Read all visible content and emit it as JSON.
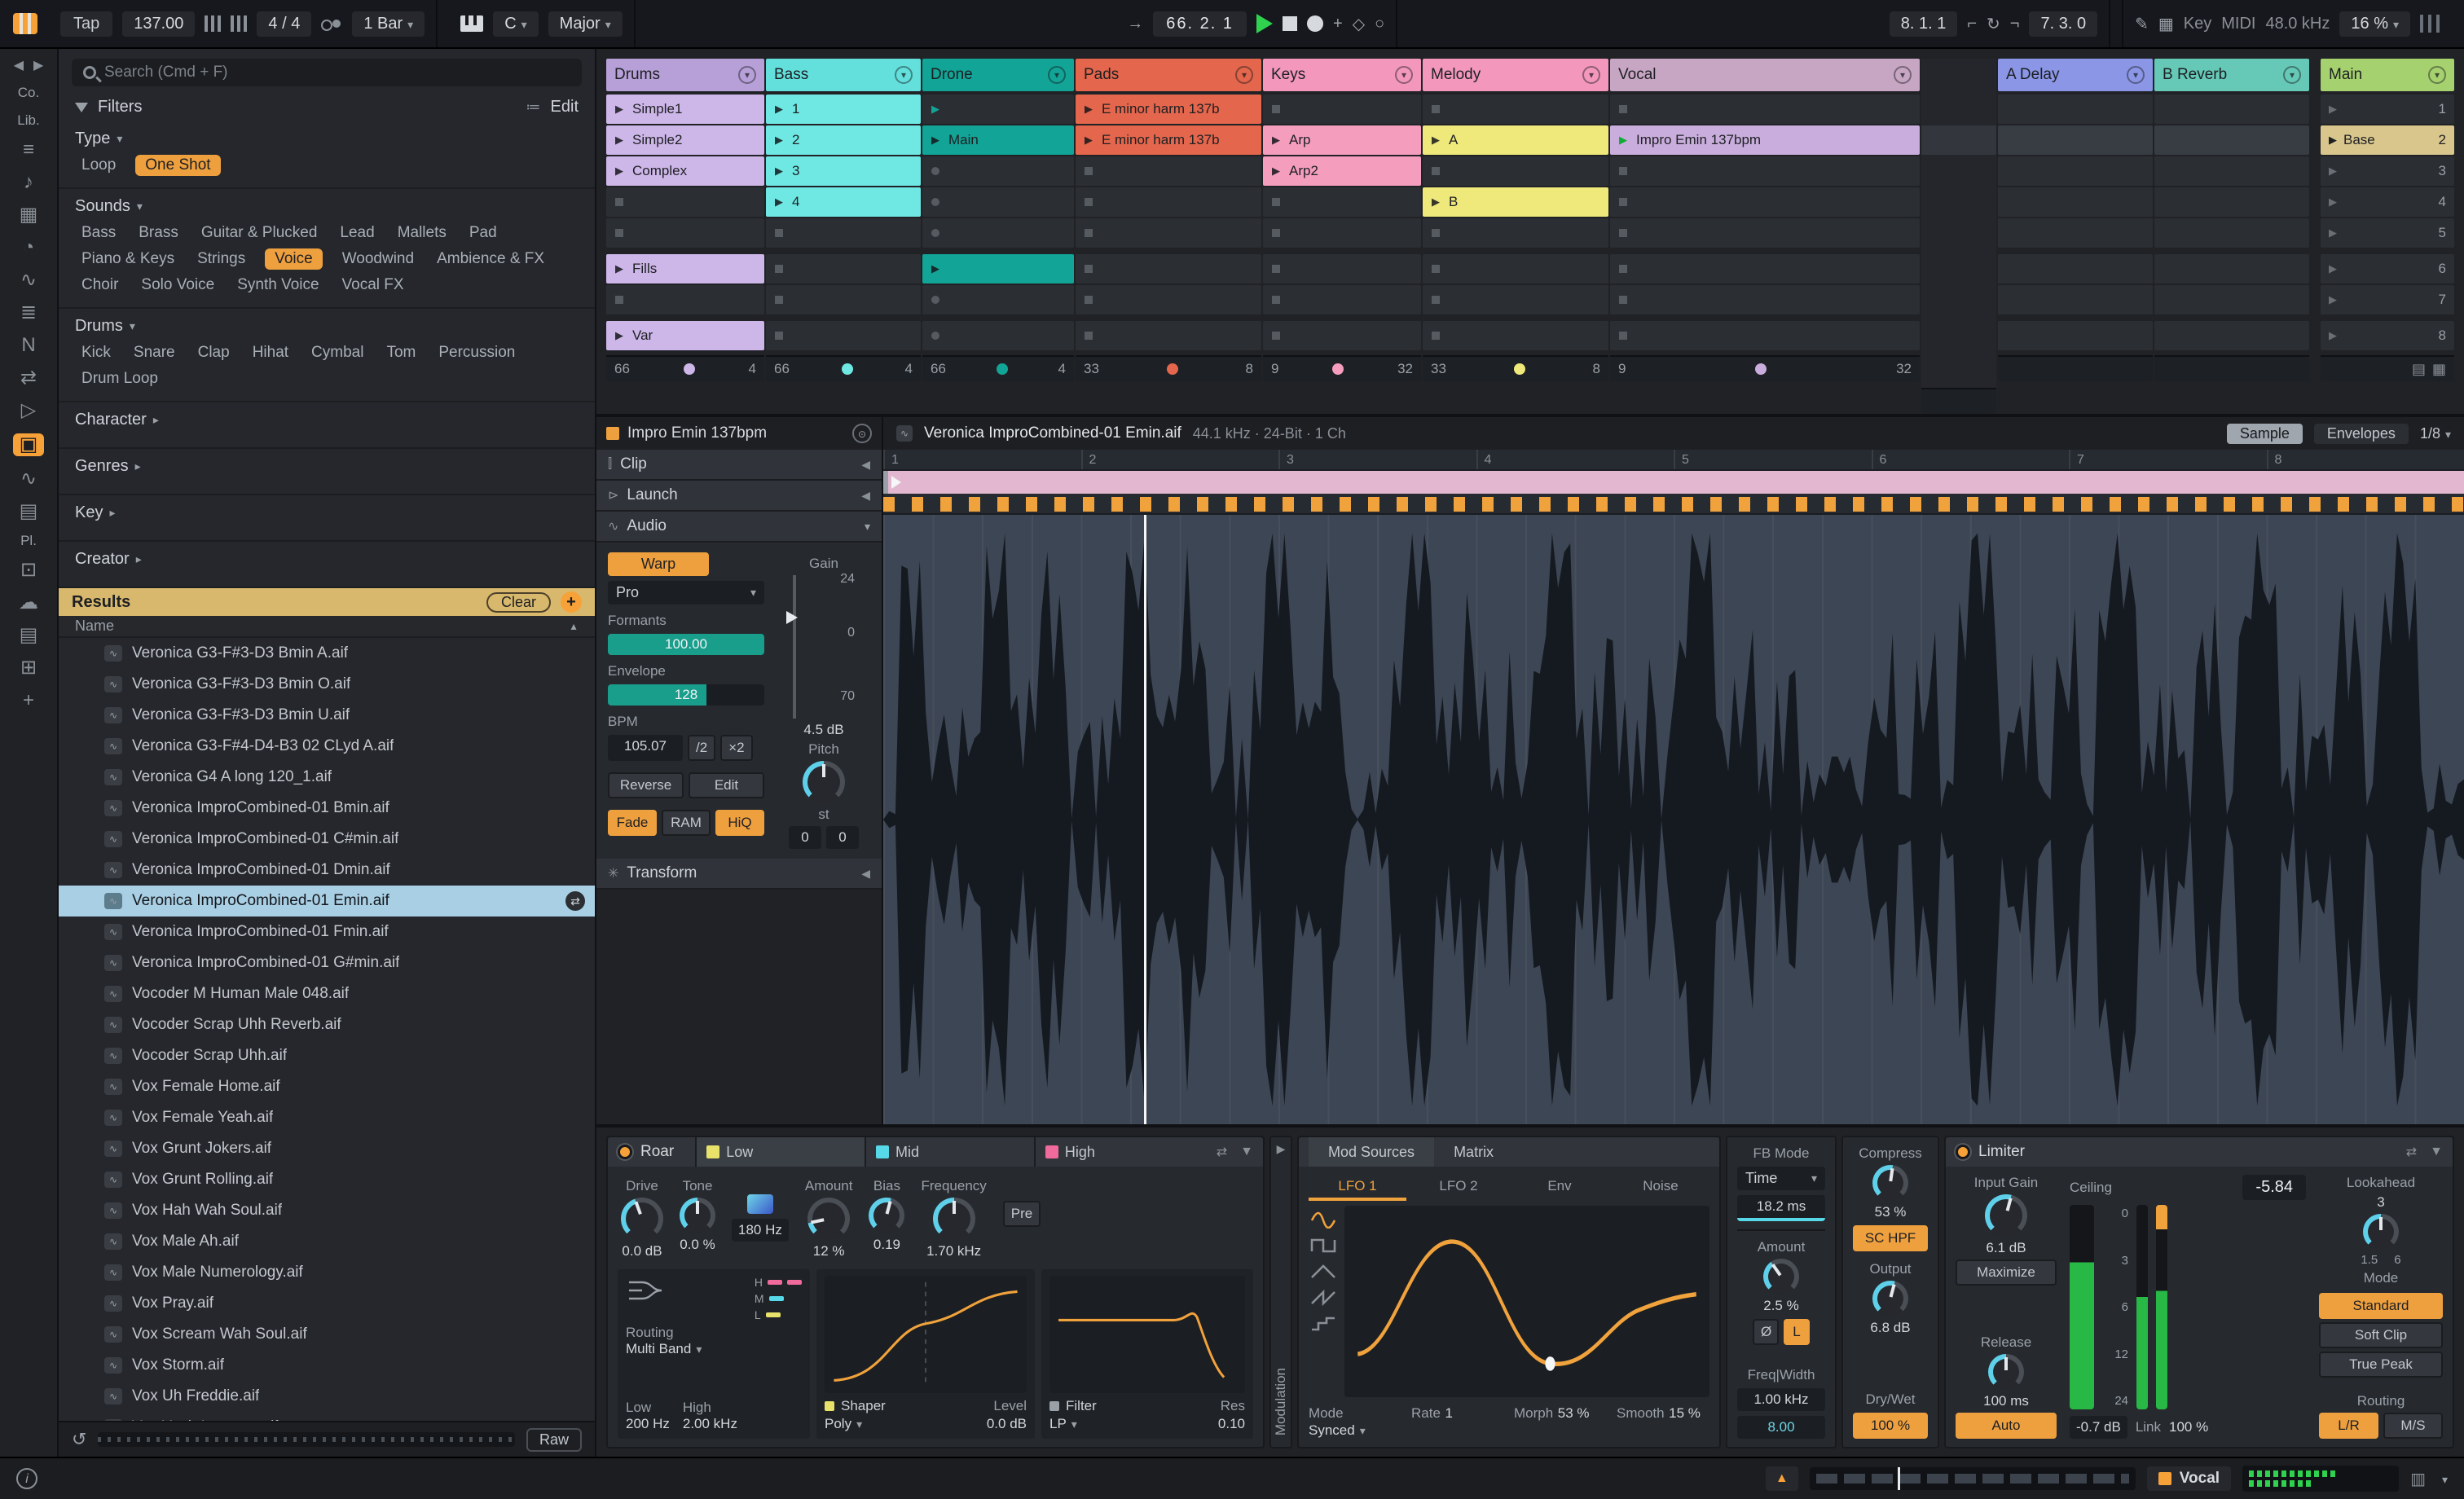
{
  "transport": {
    "tap": "Tap",
    "tempo": "137.00",
    "time_sig": "4 / 4",
    "quantize": "1 Bar",
    "key_root": "C",
    "key_scale": "Major",
    "position": "66. 2. 1",
    "loop_start": "8. 1. 1",
    "loop_length": "7. 3. 0",
    "key_map_label": "Key",
    "midi_label": "MIDI",
    "sample_rate": "48.0 kHz",
    "cpu": "16 %"
  },
  "rail": {
    "back": "◀",
    "forward": "▶",
    "collections_label": "Co.",
    "library_label": "Lib.",
    "places_label": "Pl.",
    "items": [
      {
        "g": "≡",
        "n": "categories-icon"
      },
      {
        "g": "♪",
        "n": "sounds-icon"
      },
      {
        "g": "▦",
        "n": "drums-icon"
      },
      {
        "g": "◔",
        "n": "clock-icon"
      },
      {
        "g": "∿",
        "n": "audio-effects-icon"
      },
      {
        "g": "≣",
        "n": "instruments-icon"
      },
      {
        "g": "N",
        "n": "midi-effects-icon"
      },
      {
        "g": "⇄",
        "n": "max-for-live-icon"
      },
      {
        "g": "▷",
        "n": "plugins-icon"
      },
      {
        "g": "▣",
        "n": "samples-icon",
        "active": true
      },
      {
        "g": "∿",
        "n": "grooves-icon"
      },
      {
        "g": "▤",
        "n": "templates-icon"
      }
    ],
    "bottom_items": [
      {
        "g": "⊡",
        "n": "user-library-icon"
      },
      {
        "g": "☁",
        "n": "cloud-icon"
      },
      {
        "g": "▤",
        "n": "current-project-icon"
      },
      {
        "g": "⊞",
        "n": "add-folder-icon"
      },
      {
        "g": "+",
        "n": "plus-icon"
      }
    ]
  },
  "browser": {
    "search_placeholder": "Search (Cmd + F)",
    "filters_label": "Filters",
    "edit_label": "Edit",
    "sections": [
      {
        "label": "Type",
        "arrow": "▾",
        "chips": [
          {
            "label": "Loop"
          },
          {
            "label": "One Shot",
            "active": true
          }
        ]
      },
      {
        "label": "Sounds",
        "arrow": "▾",
        "chips": [
          {
            "label": "Bass"
          },
          {
            "label": "Brass"
          },
          {
            "label": "Guitar & Plucked"
          },
          {
            "label": "Lead"
          },
          {
            "label": "Mallets"
          },
          {
            "label": "Pad"
          },
          {
            "label": "Piano & Keys"
          },
          {
            "label": "Strings"
          },
          {
            "label": "Voice",
            "active": true
          },
          {
            "label": "Woodwind"
          },
          {
            "label": "Ambience & FX"
          },
          {
            "label": "Choir"
          },
          {
            "label": "Solo Voice"
          },
          {
            "label": "Synth Voice"
          },
          {
            "label": "Vocal FX"
          }
        ]
      },
      {
        "label": "Drums",
        "arrow": "▾",
        "chips": [
          {
            "label": "Kick"
          },
          {
            "label": "Snare"
          },
          {
            "label": "Clap"
          },
          {
            "label": "Hihat"
          },
          {
            "label": "Cymbal"
          },
          {
            "label": "Tom"
          },
          {
            "label": "Percussion"
          },
          {
            "label": "Drum Loop"
          }
        ]
      },
      {
        "label": "Character",
        "arrow": "▸",
        "chips": []
      },
      {
        "label": "Genres",
        "arrow": "▸",
        "chips": []
      },
      {
        "label": "Key",
        "arrow": "▸",
        "chips": []
      },
      {
        "label": "Creator",
        "arrow": "▸",
        "chips": []
      }
    ],
    "results_label": "Results",
    "clear_label": "Clear",
    "plus_label": "+",
    "name_header": "Name",
    "files": [
      {
        "label": "Veronica G3-F#3-D3 Bmin A.aif"
      },
      {
        "label": "Veronica G3-F#3-D3 Bmin O.aif"
      },
      {
        "label": "Veronica G3-F#3-D3 Bmin U.aif"
      },
      {
        "label": "Veronica G3-F#4-D4-B3 02 CLyd A.aif"
      },
      {
        "label": "Veronica G4 A long 120_1.aif"
      },
      {
        "label": "Veronica ImproCombined-01 Bmin.aif"
      },
      {
        "label": "Veronica ImproCombined-01 C#min.aif"
      },
      {
        "label": "Veronica ImproCombined-01 Dmin.aif"
      },
      {
        "label": "Veronica ImproCombined-01 Emin.aif",
        "selected": true
      },
      {
        "label": "Veronica ImproCombined-01 Fmin.aif"
      },
      {
        "label": "Veronica ImproCombined-01 G#min.aif"
      },
      {
        "label": "Vocoder M Human Male 048.aif"
      },
      {
        "label": "Vocoder Scrap Uhh Reverb.aif"
      },
      {
        "label": "Vocoder Scrap Uhh.aif"
      },
      {
        "label": "Vox Female Home.aif"
      },
      {
        "label": "Vox Female Yeah.aif"
      },
      {
        "label": "Vox Grunt Jokers.aif"
      },
      {
        "label": "Vox Grunt Rolling.aif"
      },
      {
        "label": "Vox Hah Wah Soul.aif"
      },
      {
        "label": "Vox Male Ah.aif"
      },
      {
        "label": "Vox Male Numerology.aif"
      },
      {
        "label": "Vox Pray.aif"
      },
      {
        "label": "Vox Scream Wah Soul.aif"
      },
      {
        "label": "Vox Storm.aif"
      },
      {
        "label": "Vox Uh Freddie.aif"
      },
      {
        "label": "Vox Yeah Ironman.aif"
      }
    ],
    "raw_label": "Raw"
  },
  "session": {
    "tracks": [
      {
        "name": "Drums",
        "color": "#b7a0d8",
        "counter": {
          "l": "66",
          "r": "4",
          "c": "#cdb6e8"
        },
        "slots": [
          {
            "t": "clip",
            "label": "Simple1",
            "color": "#cdb6e8"
          },
          {
            "t": "clip",
            "label": "Simple2",
            "color": "#cdb6e8"
          },
          {
            "t": "clip",
            "label": "Complex",
            "color": "#cdb6e8"
          },
          {
            "t": "stop"
          },
          {
            "t": "stop"
          },
          {
            "t": "clip",
            "label": "Fills",
            "color": "#cdb6e8"
          },
          {
            "t": "stop"
          },
          {
            "t": "clip",
            "label": "Var",
            "color": "#cdb6e8"
          }
        ]
      },
      {
        "name": "Bass",
        "color": "#63e0dc",
        "counter": {
          "l": "66",
          "r": "4",
          "c": "#6fe8e3"
        },
        "slots": [
          {
            "t": "clip",
            "label": "1",
            "color": "#6fe8e3"
          },
          {
            "t": "clip",
            "label": "2",
            "color": "#6fe8e3"
          },
          {
            "t": "clip",
            "label": "3",
            "color": "#6fe8e3"
          },
          {
            "t": "clip",
            "label": "4",
            "color": "#6fe8e3"
          },
          {
            "t": "stop"
          },
          {
            "t": "stop"
          },
          {
            "t": "stop"
          },
          {
            "t": "stop"
          }
        ]
      },
      {
        "name": "Drone",
        "color": "#12a496",
        "counter": {
          "l": "66",
          "r": "4",
          "c": "#12a496"
        },
        "slots": [
          {
            "t": "playslot"
          },
          {
            "t": "clip",
            "label": "Main",
            "color": "#12a496"
          },
          {
            "t": "dot"
          },
          {
            "t": "dot"
          },
          {
            "t": "dot"
          },
          {
            "t": "clip",
            "label": "",
            "color": "#12a496"
          },
          {
            "t": "dot"
          },
          {
            "t": "dot"
          }
        ]
      },
      {
        "name": "Pads",
        "color": "#e4664c",
        "counter": {
          "l": "33",
          "r": "8",
          "c": "#e4664c"
        },
        "slots": [
          {
            "t": "clip",
            "label": "E minor harm 137b",
            "color": "#e4664c"
          },
          {
            "t": "clip",
            "label": "E minor harm 137b",
            "color": "#e4664c"
          },
          {
            "t": "stop"
          },
          {
            "t": "stop"
          },
          {
            "t": "stop"
          },
          {
            "t": "stop"
          },
          {
            "t": "stop"
          },
          {
            "t": "stop"
          }
        ]
      },
      {
        "name": "Keys",
        "color": "#f398bc",
        "counter": {
          "l": "9",
          "r": "32",
          "c": "#f49dbd"
        },
        "slots": [
          {
            "t": "stop"
          },
          {
            "t": "clip",
            "label": "Arp",
            "color": "#f49dbd"
          },
          {
            "t": "clip",
            "label": "Arp2",
            "color": "#f49dbd"
          },
          {
            "t": "stop"
          },
          {
            "t": "stop"
          },
          {
            "t": "stop"
          },
          {
            "t": "stop"
          },
          {
            "t": "stop"
          }
        ]
      },
      {
        "name": "Melody",
        "color": "#f398bc",
        "counter": {
          "l": "33",
          "r": "8",
          "c": "#efe87b"
        },
        "slots": [
          {
            "t": "stop"
          },
          {
            "t": "clip",
            "label": "A",
            "color": "#efe87b"
          },
          {
            "t": "stop"
          },
          {
            "t": "clip",
            "label": "B",
            "color": "#efe87b"
          },
          {
            "t": "stop"
          },
          {
            "t": "stop"
          },
          {
            "t": "stop"
          },
          {
            "t": "stop"
          }
        ]
      },
      {
        "name": "Vocal",
        "color": "#c7a6c3",
        "counter": {
          "l": "9",
          "r": "32",
          "c": "#c9addc"
        },
        "slots": [
          {
            "t": "stop"
          },
          {
            "t": "clip",
            "label": "Impro Emin 137bpm",
            "color": "#c9addc",
            "p": "green"
          },
          {
            "t": "stop"
          },
          {
            "t": "stop"
          },
          {
            "t": "stop"
          },
          {
            "t": "stop"
          },
          {
            "t": "stop"
          },
          {
            "t": "stop"
          }
        ]
      }
    ],
    "returns": [
      {
        "name": "A Delay",
        "color": "#8b97e6",
        "slots": [
          {
            "t": "empty"
          },
          {
            "t": "empty",
            "hl": true
          },
          {
            "t": "empty"
          },
          {
            "t": "empty"
          },
          {
            "t": "empty"
          },
          {
            "t": "empty"
          },
          {
            "t": "empty"
          },
          {
            "t": "empty"
          }
        ]
      },
      {
        "name": "B Reverb",
        "color": "#66c9b7",
        "slots": [
          {
            "t": "empty"
          },
          {
            "t": "empty",
            "hl": true
          },
          {
            "t": "empty"
          },
          {
            "t": "empty"
          },
          {
            "t": "empty"
          },
          {
            "t": "empty"
          },
          {
            "t": "empty"
          },
          {
            "t": "empty"
          }
        ]
      }
    ],
    "main": {
      "name": "Main",
      "color": "#a6d16f",
      "scenes": [
        {
          "n": "1"
        },
        {
          "n": "2",
          "label": "Base",
          "sel": true
        },
        {
          "n": "3"
        },
        {
          "n": "4"
        },
        {
          "n": "5"
        },
        {
          "n": "6"
        },
        {
          "n": "7"
        },
        {
          "n": "8"
        }
      ]
    }
  },
  "clip": {
    "title": "Impro Emin 137bpm",
    "section_clip": "Clip",
    "section_launch": "Launch",
    "section_audio": "Audio",
    "section_transform": "Transform",
    "warp_label": "Warp",
    "warp_mode": "Pro",
    "formants_label": "Formants",
    "formants_value": "100.00",
    "formants_pct": "100%",
    "envelope_label": "Envelope",
    "envelope_value": "128",
    "envelope_pct": "63%",
    "bpm_label": "BPM",
    "bpm_value": "105.07",
    "div2": "/2",
    "mul2": "×2",
    "gain_label": "Gain",
    "gain_tick_top": "24",
    "gain_tick_mid": "0",
    "gain_tick_low": "70",
    "gain_value": "4.5 dB",
    "pitch_label": "Pitch",
    "pitch_unit": "st",
    "pitch_st": "0",
    "pitch_fine": "0",
    "pitch_sw": 135,
    "reverse_label": "Reverse",
    "edit_label": "Edit",
    "fade_label": "Fade",
    "ram_label": "RAM",
    "hiq_label": "HiQ"
  },
  "sample": {
    "filename": "Veronica ImproCombined-01 Emin.aif",
    "specs": "44.1 kHz · 24-Bit · 1 Ch",
    "tab_sample": "Sample",
    "tab_envelopes": "Envelopes",
    "zoom": "1/8",
    "ruler": [
      "1",
      "2",
      "3",
      "4",
      "5",
      "6",
      "7",
      "8"
    ]
  },
  "devices": {
    "roar": {
      "title": "Roar",
      "tabs": [
        {
          "label": "Low",
          "color": "#e8e26a",
          "on": true
        },
        {
          "label": "Mid",
          "color": "#57d8e8"
        },
        {
          "label": "High",
          "color": "#f06a9c"
        }
      ],
      "drive": {
        "label": "Drive",
        "value": "0.0 dB",
        "sw": 115
      },
      "tone": {
        "label": "Tone",
        "value": "0.0 %",
        "sw": 135
      },
      "xover": "180 Hz",
      "amount": {
        "label": "Amount",
        "value": "12 %",
        "sw": 33
      },
      "bias": {
        "label": "Bias",
        "value": "0.19",
        "sw": 150
      },
      "freq": {
        "label": "Frequency",
        "value": "1.70 kHz",
        "sw": 135
      },
      "pre_label": "Pre",
      "routing_label": "Routing",
      "routing_mode": "Multi Band",
      "low_label": "Low",
      "low_value": "200 Hz",
      "high_label": "High",
      "high_value": "2.00 kHz",
      "shaper_label": "Shaper",
      "shaper_mode": "Poly",
      "level_label": "Level",
      "level_value": "0.0 dB",
      "filter_label": "Filter",
      "filter_mode": "LP",
      "res_label": "Res",
      "res_value": "0.10",
      "modulation_label": "Modulation",
      "band_h": "H",
      "band_m": "M",
      "band_l": "L"
    },
    "mod": {
      "tab_sources": "Mod Sources",
      "tab_matrix": "Matrix",
      "lfo_tabs": [
        {
          "label": "LFO 1",
          "on": true
        },
        {
          "label": "LFO 2"
        },
        {
          "label": "Env"
        },
        {
          "label": "Noise"
        }
      ],
      "mode_label": "Mode",
      "mode_value": "Synced",
      "rate_label": "Rate",
      "rate_value": "1",
      "morph_label": "Morph",
      "morph_value": "53 %",
      "smooth_label": "Smooth",
      "smooth_value": "15 %"
    },
    "fb": {
      "label": "FB Mode",
      "mode": "Time",
      "time": "18.2 ms",
      "amount_label": "Amount",
      "amount_value": "2.5 %",
      "amount_sw": 100,
      "phase": "Ø",
      "listen": "L",
      "freqwidth_label": "Freq|Width",
      "freq": "1.00 kHz",
      "width": "8.00"
    },
    "out": {
      "compress_label": "Compress",
      "compress_value": "53 %",
      "compress_sw": 143,
      "schpf": "SC HPF",
      "output_label": "Output",
      "output_value": "6.8 dB",
      "output_sw": 150,
      "drywet_label": "Dry/Wet",
      "drywet_value": "100 %"
    },
    "limiter": {
      "title": "Limiter",
      "input_label": "Input Gain",
      "input_value": "6.1 dB",
      "input_sw": 150,
      "maximize": "Maximize",
      "ceiling_label": "Ceiling",
      "ceiling_value": "-5.84",
      "meter_ticks": [
        "0",
        "3",
        "6",
        "12",
        "24"
      ],
      "lookahead_label": "Lookahead",
      "lookahead_value": "3",
      "lookahead_min": "1.5",
      "lookahead_max": "6",
      "lookahead_sw": 135,
      "mode_label": "Mode",
      "mode_standard": "Standard",
      "soft_clip": "Soft Clip",
      "true_peak": "True Peak",
      "release_label": "Release",
      "release_value": "100 ms",
      "release_sw": 135,
      "auto": "Auto",
      "gr_value": "-0.7 dB",
      "link_label": "Link",
      "link_value": "100 %",
      "routing_label": "Routing",
      "lr": "L/R",
      "ms": "M/S"
    }
  },
  "status": {
    "track": "Vocal"
  }
}
